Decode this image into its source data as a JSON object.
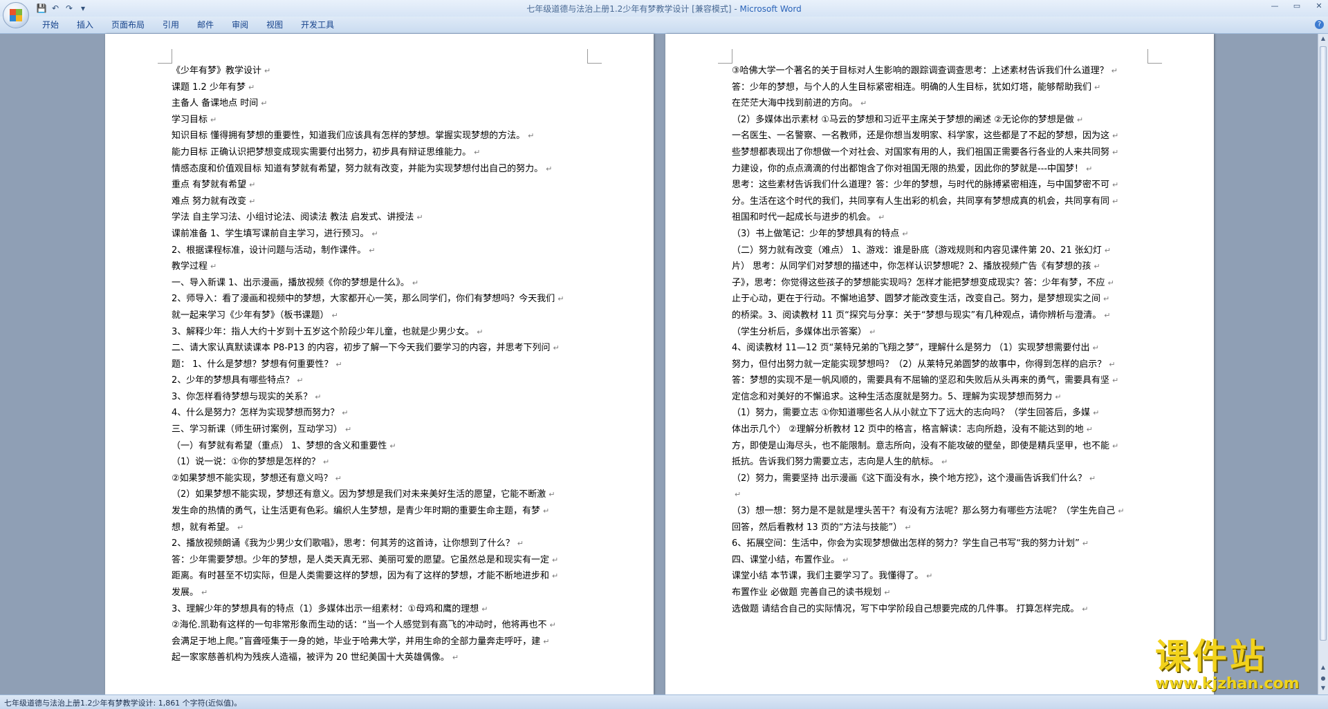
{
  "window": {
    "title": "七年级道德与法治上册1.2少年有梦教学设计 [兼容模式] - ",
    "app_name": "Microsoft Word"
  },
  "quick_access": {
    "save_icon": "💾",
    "undo_icon": "↶",
    "redo_icon": "↷",
    "more_icon": "▾"
  },
  "window_controls": {
    "minimize": "—",
    "maximize": "▭",
    "close": "✕"
  },
  "ribbon": {
    "tabs": [
      "开始",
      "插入",
      "页面布局",
      "引用",
      "邮件",
      "审阅",
      "视图",
      "开发工具"
    ],
    "help": "?"
  },
  "pages": [
    {
      "lines": [
        "《少年有梦》教学设计",
        "课题 1.2 少年有梦",
        "主备人   备课地点   时间",
        "学习目标",
        "知识目标 懂得拥有梦想的重要性，知道我们应该具有怎样的梦想。掌握实现梦想的方法。",
        "能力目标 正确认识把梦想变成现实需要付出努力，初步具有辩证思维能力。",
        "情感态度和价值观目标 知道有梦就有希望，努力就有改变，并能为实现梦想付出自己的努力。",
        "      重点 有梦就有希望",
        "难点 努力就有改变",
        "学法 自主学习法、小组讨论法、阅读法 教法 启发式、讲授法",
        "课前准备 1、学生填写课前自主学习，进行预习。",
        "   2、根据课程标准，设计问题与活动，制作课件。",
        "教学过程",
        "      一、导入新课        1、出示漫画，播放视频《你的梦想是什么》。",
        "2、师导入：看了漫画和视频中的梦想，大家都开心一笑，那么同学们，你们有梦想吗？今天我们",
        "就一起来学习《少年有梦》（板书课题）",
        "3、解释少年：指人大约十岁到十五岁这个阶段少年儿童，也就是少男少女。",
        "二、请大家认真默读课本  P8-P13  的内容，初步了解一下今天我们要学习的内容，并思考下列问",
        "题：       1、什么是梦想？梦想有何重要性？",
        "2、少年的梦想具有哪些特点？",
        "3、你怎样看待梦想与现实的关系？",
        "4、什么是努力？怎样为实现梦想而努力？",
        "三、学习新课（师生研讨案例，互动学习）",
        "（一）有梦就有希望（重点）       1、梦想的含义和重要性",
        "（1）说一说：①你的梦想是怎样的？",
        "②如果梦想不能实现，梦想还有意义吗？",
        "    （2）如果梦想不能实现，梦想还有意义。因为梦想是我们对未来美好生活的愿望，它能不断激",
        "发生命的热情的勇气，让生活更有色彩。编织人生梦想，是青少年时期的重要生命主题，有梦",
        "想，就有希望。",
        "2、播放视频朗诵《我为少男少女们歌唱》，思考：何其芳的这首诗，让你想到了什么？",
        "答：少年需要梦想。少年的梦想，是人类天真无邪、美丽可爱的愿望。它虽然总是和现实有一定",
        "距离。有时甚至不切实际，但是人类需要这样的梦想，因为有了这样的梦想，才能不断地进步和",
        "发展。",
        "3、理解少年的梦想具有的特点（1）多媒体出示一组素材：①母鸡和鹰的理想",
        "②海伦.凯勒有这样的一句非常形象而生动的话：“当一个人感觉到有高飞的冲动时，他将再也不",
        "会满足于地上爬。”盲聋哑集于一身的她，毕业于哈弗大学，并用生命的全部力量奔走呼吁，建",
        "起一家家慈善机构为残疾人造福，被评为 20 世纪美国十大英雄偶像。"
      ]
    },
    {
      "lines": [
        "③哈佛大学一个著名的关于目标对人生影响的跟踪调查调查思考：上述素材告诉我们什么道理？",
        "      答：少年的梦想，与个人的人生目标紧密相连。明确的人生目标，犹如灯塔，能够帮助我们",
        "在茫茫大海中找到前进的方向。",
        "（2）多媒体出示素材       ①马云的梦想和习近平主席关于梦想的阐述       ②无论你的梦想是做",
        "一名医生、一名警察、一名教师，还是你想当发明家、科学家，这些都是了不起的梦想，因为这",
        "些梦想都表现出了你想做一个对社会、对国家有用的人，我们祖国正需要各行各业的人来共同努",
        "力建设，你的点点滴滴的付出都饱含了你对祖国无限的热爱，因此你的梦就是---中国梦！",
        "思考：这些素材告诉我们什么道理？答：少年的梦想，与时代的脉搏紧密相连，与中国梦密不可",
        "分。生活在这个时代的我们，共同享有人生出彩的机会，共同享有梦想成真的机会，共同享有同",
        "祖国和时代一起成长与进步的机会。",
        "（3）书上做笔记：少年的梦想具有的特点",
        "（二）努力就有改变（难点）       1、游戏：谁是卧底（游戏规则和内容见课件第  20、21 张幻灯",
        "片）         思考：从同学们对梦想的描述中，你怎样认识梦想呢？2、播放视频广告《有梦想的孩",
        "子》，思考：你觉得这些孩子的梦想能实现吗？怎样才能把梦想变成现实？答：少年有梦，不应",
        "止于心动，更在于行动。不懈地追梦、圆梦才能改变生活，改变自己。努力，是梦想现实之间",
        "的桥梁。3、阅读教材  11 页“探究与分享：关于“梦想与现实”有几种观点，请你辨析与澄清。",
        "（学生分析后，多媒体出示答案）",
        "4、阅读教材  11—12 页“莱特兄弟的飞翔之梦”，理解什么是努力       （1）实现梦想需要付出",
        "努力，但付出努力就一定能实现梦想吗？（2）从莱特兄弟圆梦的故事中，你得到怎样的启示？",
        "答：梦想的实现不是一帆风顺的，需要具有不屈输的坚忍和失败后从头再来的勇气，需要具有坚",
        "定信念和对美好的不懈追求。这种生活态度就是努力。5、理解为实现梦想而努力",
        "（1）努力，需要立志       ①你知道哪些名人从小就立下了远大的志向吗？（学生回答后，多媒",
        "体出示几个）       ②理解分析教材  12  页中的格言，格言解读：志向所趋，没有不能达到的地",
        "方，即使是山海尽头，也不能限制。意志所向，没有不能攻破的壁垒，即使是精兵坚甲，也不能",
        "抵抗。告诉我们努力需要立志，志向是人生的航标。",
        "（2）努力，需要坚持       出示漫画《这下面没有水，换个地方挖》，这个漫画告诉我们什么？",
        "",
        "（3）想一想：努力是不是就是埋头苦干？有没有方法呢？那么努力有哪些方法呢？（学生先自己",
        "回答，然后看教材 13 页的“方法与技能”）",
        "   6、拓展空间：生活中，你会为实现梦想做出怎样的努力？学生自己书写“我的努力计划”",
        "   四、课堂小结，布置作业。",
        "课堂小结 本节课，我们主要学习了。我懂得了。",
        "布置作业 必做题 完善自己的读书规划",
        "选做题 请结合自己的实际情况，写下中学阶段自己想要完成的几件事。        打算怎样完成。"
      ]
    }
  ],
  "paragraph_mark": "↵",
  "status_bar": {
    "text": "七年级道德与法治上册1.2少年有梦教学设计: 1,861 个字符(近似值)。"
  },
  "watermark": {
    "title": "课件站",
    "url": "www.kjzhan.com"
  }
}
